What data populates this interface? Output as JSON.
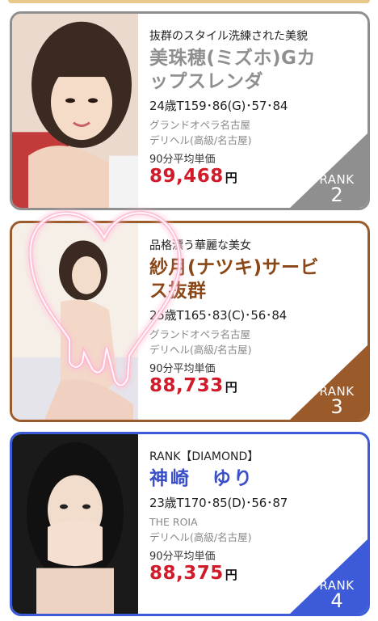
{
  "cards": [
    {
      "catchphrase": "抜群のスタイル洗練された美貌",
      "name": "美珠穂(ミズホ)Gカップスレンダ",
      "name_line1": "美珠穂(ミズホ)Gカ",
      "name_line2": "ップスレンダ",
      "specs": "24歳T159･86(G)･57･84",
      "shop_name": "グランドオペラ名古屋",
      "shop_genre": "デリヘル(高級/名古屋)",
      "avg_label": "90分平均単価",
      "price": "89,468",
      "currency": "円",
      "rank_label": "RANK",
      "rank_number": "2",
      "accent_color": "#8f8f8f"
    },
    {
      "catchphrase": "品格漂う華麗な美女",
      "name_line1": "紗月(ナツキ)サービ",
      "name_line2": "ス抜群",
      "specs": "25歳T165･83(C)･56･84",
      "shop_name": "グランドオペラ名古屋",
      "shop_genre": "デリヘル(高級/名古屋)",
      "avg_label": "90分平均単価",
      "price": "88,733",
      "currency": "円",
      "rank_label": "RANK",
      "rank_number": "3",
      "accent_color": "#9a5a2a"
    },
    {
      "catchphrase": "RANK【DIAMOND】",
      "name_line1": "神崎　ゆり",
      "specs": "23歳T170･85(D)･56･87",
      "shop_name": "THE ROIA",
      "shop_genre": "デリヘル(高級/名古屋)",
      "avg_label": "90分平均単価",
      "price": "88,375",
      "currency": "円",
      "rank_label": "RANK",
      "rank_number": "4",
      "accent_color": "#3d5bd8"
    }
  ]
}
